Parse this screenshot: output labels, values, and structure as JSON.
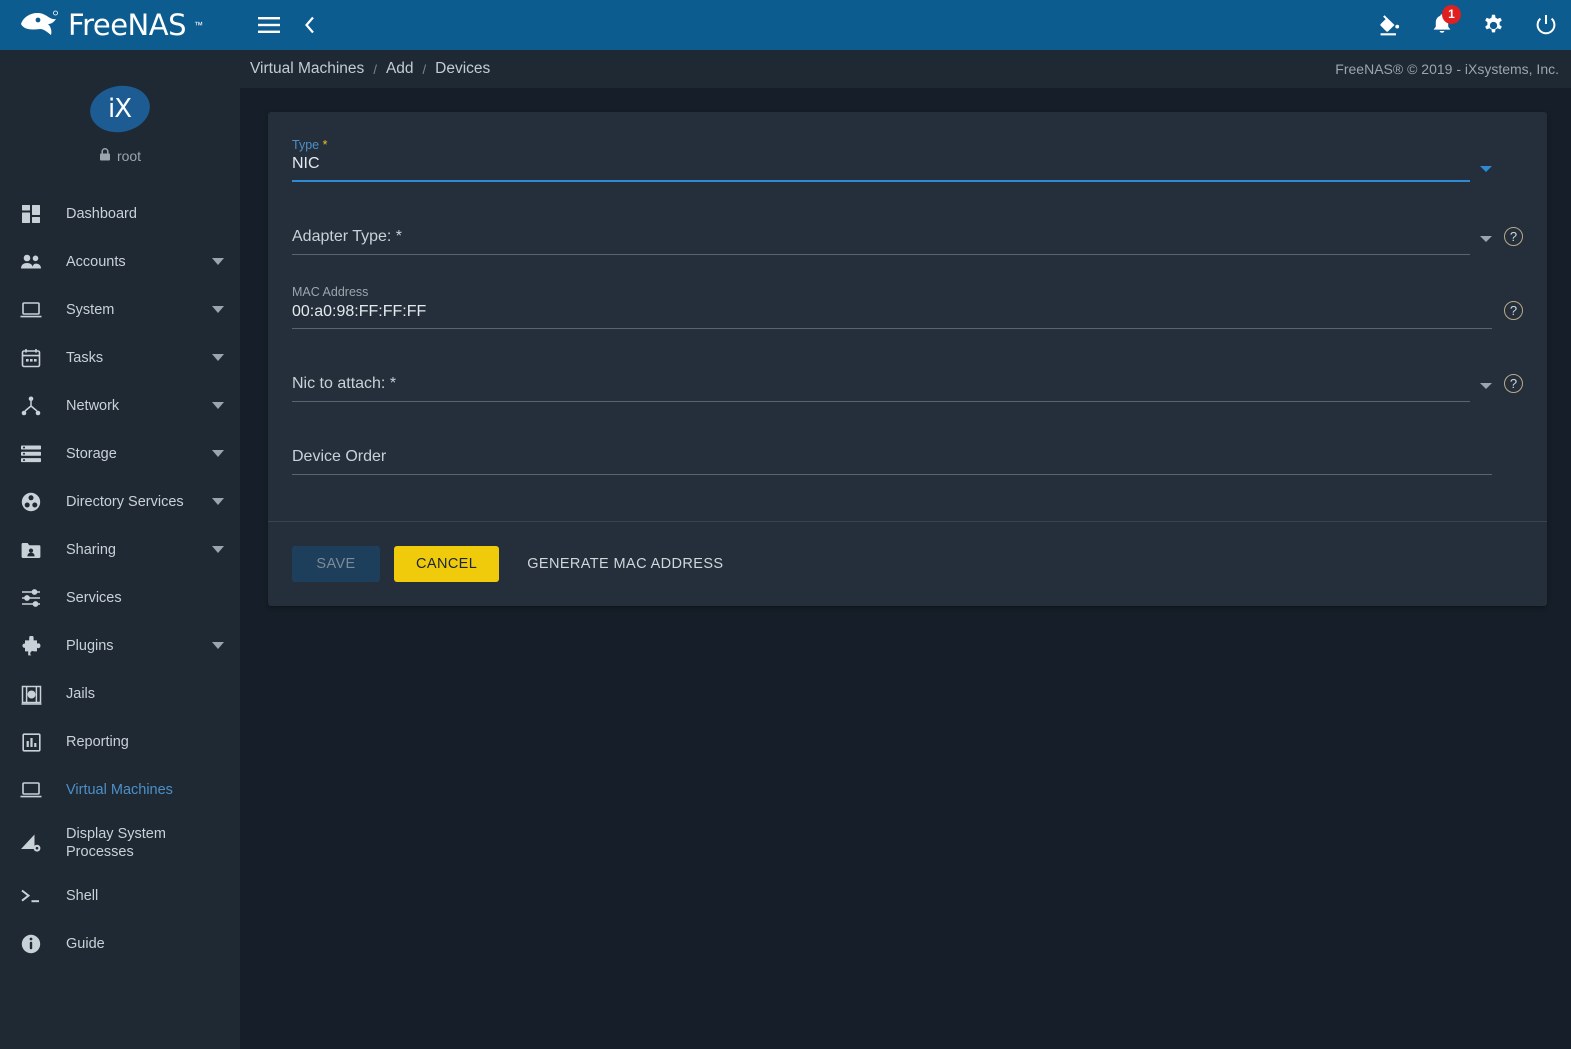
{
  "brand": {
    "name": "FreeNAS",
    "trademark": "™"
  },
  "sidebar": {
    "user": {
      "name": "root",
      "avatar_text": "iX",
      "lock_icon": "lock-icon"
    },
    "items": [
      {
        "label": "Dashboard",
        "icon": "dashboard-icon",
        "expandable": false,
        "active": false
      },
      {
        "label": "Accounts",
        "icon": "accounts-icon",
        "expandable": true,
        "active": false
      },
      {
        "label": "System",
        "icon": "system-icon",
        "expandable": true,
        "active": false
      },
      {
        "label": "Tasks",
        "icon": "tasks-icon",
        "expandable": true,
        "active": false
      },
      {
        "label": "Network",
        "icon": "network-icon",
        "expandable": true,
        "active": false
      },
      {
        "label": "Storage",
        "icon": "storage-icon",
        "expandable": true,
        "active": false
      },
      {
        "label": "Directory Services",
        "icon": "directory-services-icon",
        "expandable": true,
        "active": false
      },
      {
        "label": "Sharing",
        "icon": "sharing-icon",
        "expandable": true,
        "active": false
      },
      {
        "label": "Services",
        "icon": "services-icon",
        "expandable": false,
        "active": false
      },
      {
        "label": "Plugins",
        "icon": "plugins-icon",
        "expandable": true,
        "active": false
      },
      {
        "label": "Jails",
        "icon": "jails-icon",
        "expandable": false,
        "active": false
      },
      {
        "label": "Reporting",
        "icon": "reporting-icon",
        "expandable": false,
        "active": false
      },
      {
        "label": "Virtual Machines",
        "icon": "virtual-machines-icon",
        "expandable": false,
        "active": true
      },
      {
        "label": "Display System Processes",
        "icon": "display-system-processes-icon",
        "expandable": false,
        "active": false
      },
      {
        "label": "Shell",
        "icon": "shell-icon",
        "expandable": false,
        "active": false
      },
      {
        "label": "Guide",
        "icon": "guide-icon",
        "expandable": false,
        "active": false
      }
    ]
  },
  "topbar": {
    "menu_icon": "hamburger-menu-icon",
    "back_icon": "chevron-left-icon",
    "theme_icon": "paint-bucket-icon",
    "notifications_icon": "bell-icon",
    "notifications_count": "1",
    "settings_icon": "gear-icon",
    "power_icon": "power-icon"
  },
  "breadcrumb": {
    "items": [
      "Virtual Machines",
      "Add",
      "Devices"
    ],
    "separator": "/"
  },
  "footer": {
    "copyright": "FreeNAS® © 2019 - iXsystems, Inc."
  },
  "form": {
    "type": {
      "label": "Type",
      "required_marker": "*",
      "value": "NIC",
      "caret_icon": "chevron-down-icon"
    },
    "adapter_type": {
      "label": "Adapter Type: *",
      "value": "",
      "caret_icon": "chevron-down-icon",
      "help_icon": "help-circle-icon"
    },
    "mac_address": {
      "label": "MAC Address",
      "value": "00:a0:98:FF:FF:FF",
      "help_icon": "help-circle-icon"
    },
    "nic_to_attach": {
      "label": "Nic to attach: *",
      "value": "",
      "caret_icon": "chevron-down-icon",
      "help_icon": "help-circle-icon"
    },
    "device_order": {
      "label": "Device Order",
      "value": ""
    },
    "actions": {
      "save": "SAVE",
      "cancel": "CANCEL",
      "generate_mac": "GENERATE MAC ADDRESS"
    }
  }
}
